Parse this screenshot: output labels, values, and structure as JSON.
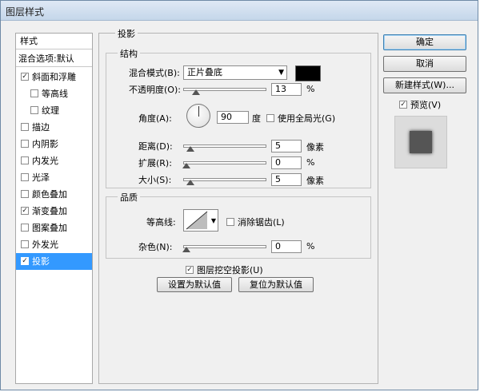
{
  "window": {
    "title": "图层样式"
  },
  "style_list": {
    "header": "样式",
    "blend_options": "混合选项:默认",
    "items": [
      {
        "label": "斜面和浮雕",
        "checked": true,
        "level": "top"
      },
      {
        "label": "等高线",
        "checked": false,
        "level": "sub"
      },
      {
        "label": "纹理",
        "checked": false,
        "level": "sub"
      },
      {
        "label": "描边",
        "checked": false,
        "level": "top"
      },
      {
        "label": "内阴影",
        "checked": false,
        "level": "top"
      },
      {
        "label": "内发光",
        "checked": false,
        "level": "top"
      },
      {
        "label": "光泽",
        "checked": false,
        "level": "top"
      },
      {
        "label": "颜色叠加",
        "checked": false,
        "level": "top"
      },
      {
        "label": "渐变叠加",
        "checked": true,
        "level": "top"
      },
      {
        "label": "图案叠加",
        "checked": false,
        "level": "top"
      },
      {
        "label": "外发光",
        "checked": false,
        "level": "top"
      },
      {
        "label": "投影",
        "checked": true,
        "level": "top",
        "selected": true
      }
    ]
  },
  "drop_shadow": {
    "title": "投影",
    "structure": {
      "title": "结构",
      "blend_mode_label": "混合模式(B):",
      "blend_mode_value": "正片叠底",
      "blend_color": "#000000",
      "opacity_label": "不透明度(O):",
      "opacity_value": "13",
      "opacity_unit": "%",
      "angle_label": "角度(A):",
      "angle_value": "90",
      "angle_unit": "度",
      "global_light_label": "使用全局光(G)",
      "global_light_checked": false,
      "distance_label": "距离(D):",
      "distance_value": "5",
      "distance_unit": "像素",
      "spread_label": "扩展(R):",
      "spread_value": "0",
      "spread_unit": "%",
      "size_label": "大小(S):",
      "size_value": "5",
      "size_unit": "像素"
    },
    "quality": {
      "title": "品质",
      "contour_label": "等高线:",
      "antialias_label": "消除锯齿(L)",
      "antialias_checked": false,
      "noise_label": "杂色(N):",
      "noise_value": "0",
      "noise_unit": "%"
    },
    "knockout_label": "图层挖空投影(U)",
    "knockout_checked": true,
    "make_default_label": "设置为默认值",
    "reset_default_label": "复位为默认值"
  },
  "buttons": {
    "ok": "确定",
    "cancel": "取消",
    "new_style": "新建样式(W)...",
    "preview_label": "预览(V)",
    "preview_checked": true
  }
}
